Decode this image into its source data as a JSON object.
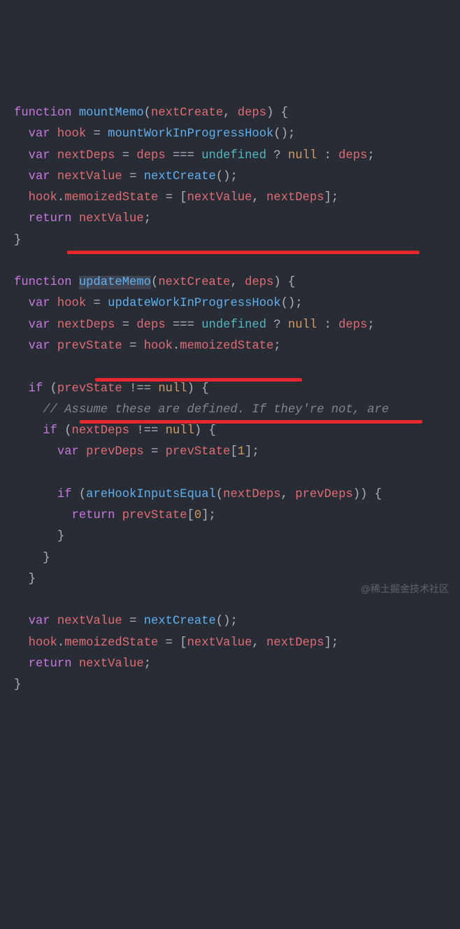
{
  "tokens": [
    {
      "t": "function",
      "c": "kw"
    },
    {
      "t": " "
    },
    {
      "t": "mountMemo",
      "c": "fn"
    },
    {
      "t": "("
    },
    {
      "t": "nextCreate",
      "c": "var"
    },
    {
      "t": ", "
    },
    {
      "t": "deps",
      "c": "var"
    },
    {
      "t": ")"
    },
    {
      "t": " {"
    },
    {
      "t": "\n"
    },
    {
      "t": "  "
    },
    {
      "t": "var",
      "c": "kw"
    },
    {
      "t": " "
    },
    {
      "t": "hook",
      "c": "var"
    },
    {
      "t": " = "
    },
    {
      "t": "mountWorkInProgressHook",
      "c": "fn"
    },
    {
      "t": "();"
    },
    {
      "t": "\n"
    },
    {
      "t": "  "
    },
    {
      "t": "var",
      "c": "kw"
    },
    {
      "t": " "
    },
    {
      "t": "nextDeps",
      "c": "var"
    },
    {
      "t": " = "
    },
    {
      "t": "deps",
      "c": "var"
    },
    {
      "t": " === "
    },
    {
      "t": "undefined",
      "c": "lit"
    },
    {
      "t": " ? "
    },
    {
      "t": "null",
      "c": "null"
    },
    {
      "t": " : "
    },
    {
      "t": "deps",
      "c": "var"
    },
    {
      "t": ";"
    },
    {
      "t": "\n"
    },
    {
      "t": "  "
    },
    {
      "t": "var",
      "c": "kw"
    },
    {
      "t": " "
    },
    {
      "t": "nextValue",
      "c": "var"
    },
    {
      "t": " = "
    },
    {
      "t": "nextCreate",
      "c": "fn"
    },
    {
      "t": "();"
    },
    {
      "t": "\n"
    },
    {
      "t": "  "
    },
    {
      "t": "hook",
      "c": "var"
    },
    {
      "t": "."
    },
    {
      "t": "memoizedState",
      "c": "prop"
    },
    {
      "t": " = ["
    },
    {
      "t": "nextValue",
      "c": "var"
    },
    {
      "t": ", "
    },
    {
      "t": "nextDeps",
      "c": "var"
    },
    {
      "t": "];"
    },
    {
      "t": "\n"
    },
    {
      "t": "  "
    },
    {
      "t": "return",
      "c": "kw"
    },
    {
      "t": " "
    },
    {
      "t": "nextValue",
      "c": "var"
    },
    {
      "t": ";"
    },
    {
      "t": "\n"
    },
    {
      "t": "}"
    },
    {
      "t": "\n"
    },
    {
      "t": "\n"
    },
    {
      "t": "function",
      "c": "kw"
    },
    {
      "t": " "
    },
    {
      "t": "updateMemo",
      "c": "fn sel"
    },
    {
      "t": "("
    },
    {
      "t": "nextCreate",
      "c": "var"
    },
    {
      "t": ", "
    },
    {
      "t": "deps",
      "c": "var"
    },
    {
      "t": ")"
    },
    {
      "t": " {"
    },
    {
      "t": "\n"
    },
    {
      "t": "  "
    },
    {
      "t": "var",
      "c": "kw"
    },
    {
      "t": " "
    },
    {
      "t": "hook",
      "c": "var"
    },
    {
      "t": " = "
    },
    {
      "t": "updateWorkInProgressHook",
      "c": "fn"
    },
    {
      "t": "();"
    },
    {
      "t": "\n"
    },
    {
      "t": "  "
    },
    {
      "t": "var",
      "c": "kw"
    },
    {
      "t": " "
    },
    {
      "t": "nextDeps",
      "c": "var"
    },
    {
      "t": " = "
    },
    {
      "t": "deps",
      "c": "var"
    },
    {
      "t": " === "
    },
    {
      "t": "undefined",
      "c": "lit"
    },
    {
      "t": " ? "
    },
    {
      "t": "null",
      "c": "null"
    },
    {
      "t": " : "
    },
    {
      "t": "deps",
      "c": "var"
    },
    {
      "t": ";"
    },
    {
      "t": "\n"
    },
    {
      "t": "  "
    },
    {
      "t": "var",
      "c": "kw"
    },
    {
      "t": " "
    },
    {
      "t": "prevState",
      "c": "var"
    },
    {
      "t": " = "
    },
    {
      "t": "hook",
      "c": "var"
    },
    {
      "t": "."
    },
    {
      "t": "memoizedState",
      "c": "prop"
    },
    {
      "t": ";"
    },
    {
      "t": "\n"
    },
    {
      "t": "\n"
    },
    {
      "t": "  "
    },
    {
      "t": "if",
      "c": "kw"
    },
    {
      "t": " ("
    },
    {
      "t": "prevState",
      "c": "var"
    },
    {
      "t": " !== "
    },
    {
      "t": "null",
      "c": "null"
    },
    {
      "t": ") {"
    },
    {
      "t": "\n"
    },
    {
      "t": "    "
    },
    {
      "t": "// Assume these are defined. If they're not, are",
      "c": "comment"
    },
    {
      "t": "\n"
    },
    {
      "t": "    "
    },
    {
      "t": "if",
      "c": "kw"
    },
    {
      "t": " ("
    },
    {
      "t": "nextDeps",
      "c": "var"
    },
    {
      "t": " !== "
    },
    {
      "t": "null",
      "c": "null"
    },
    {
      "t": ") {"
    },
    {
      "t": "\n"
    },
    {
      "t": "      "
    },
    {
      "t": "var",
      "c": "kw"
    },
    {
      "t": " "
    },
    {
      "t": "prevDeps",
      "c": "var"
    },
    {
      "t": " = "
    },
    {
      "t": "prevState",
      "c": "var"
    },
    {
      "t": "["
    },
    {
      "t": "1",
      "c": "num"
    },
    {
      "t": "];"
    },
    {
      "t": "\n"
    },
    {
      "t": "\n"
    },
    {
      "t": "      "
    },
    {
      "t": "if",
      "c": "kw"
    },
    {
      "t": " ("
    },
    {
      "t": "areHookInputsEqual",
      "c": "fn"
    },
    {
      "t": "("
    },
    {
      "t": "nextDeps",
      "c": "var"
    },
    {
      "t": ", "
    },
    {
      "t": "prevDeps",
      "c": "var"
    },
    {
      "t": ")) {"
    },
    {
      "t": "\n"
    },
    {
      "t": "        "
    },
    {
      "t": "return",
      "c": "kw"
    },
    {
      "t": " "
    },
    {
      "t": "prevState",
      "c": "var"
    },
    {
      "t": "["
    },
    {
      "t": "0",
      "c": "num"
    },
    {
      "t": "];"
    },
    {
      "t": "\n"
    },
    {
      "t": "      }"
    },
    {
      "t": "\n"
    },
    {
      "t": "    }"
    },
    {
      "t": "\n"
    },
    {
      "t": "  }"
    },
    {
      "t": "\n"
    },
    {
      "t": "\n"
    },
    {
      "t": "  "
    },
    {
      "t": "var",
      "c": "kw"
    },
    {
      "t": " "
    },
    {
      "t": "nextValue",
      "c": "var"
    },
    {
      "t": " = "
    },
    {
      "t": "nextCreate",
      "c": "fn"
    },
    {
      "t": "();"
    },
    {
      "t": "\n"
    },
    {
      "t": "  "
    },
    {
      "t": "hook",
      "c": "var"
    },
    {
      "t": "."
    },
    {
      "t": "memoizedState",
      "c": "prop"
    },
    {
      "t": " = ["
    },
    {
      "t": "nextValue",
      "c": "var"
    },
    {
      "t": ", "
    },
    {
      "t": "nextDeps",
      "c": "var"
    },
    {
      "t": "];"
    },
    {
      "t": "\n"
    },
    {
      "t": "  "
    },
    {
      "t": "return",
      "c": "kw"
    },
    {
      "t": " "
    },
    {
      "t": "nextValue",
      "c": "var"
    },
    {
      "t": ";"
    },
    {
      "t": "\n"
    },
    {
      "t": "}"
    }
  ],
  "watermark": "@稀土掘金技术社区"
}
